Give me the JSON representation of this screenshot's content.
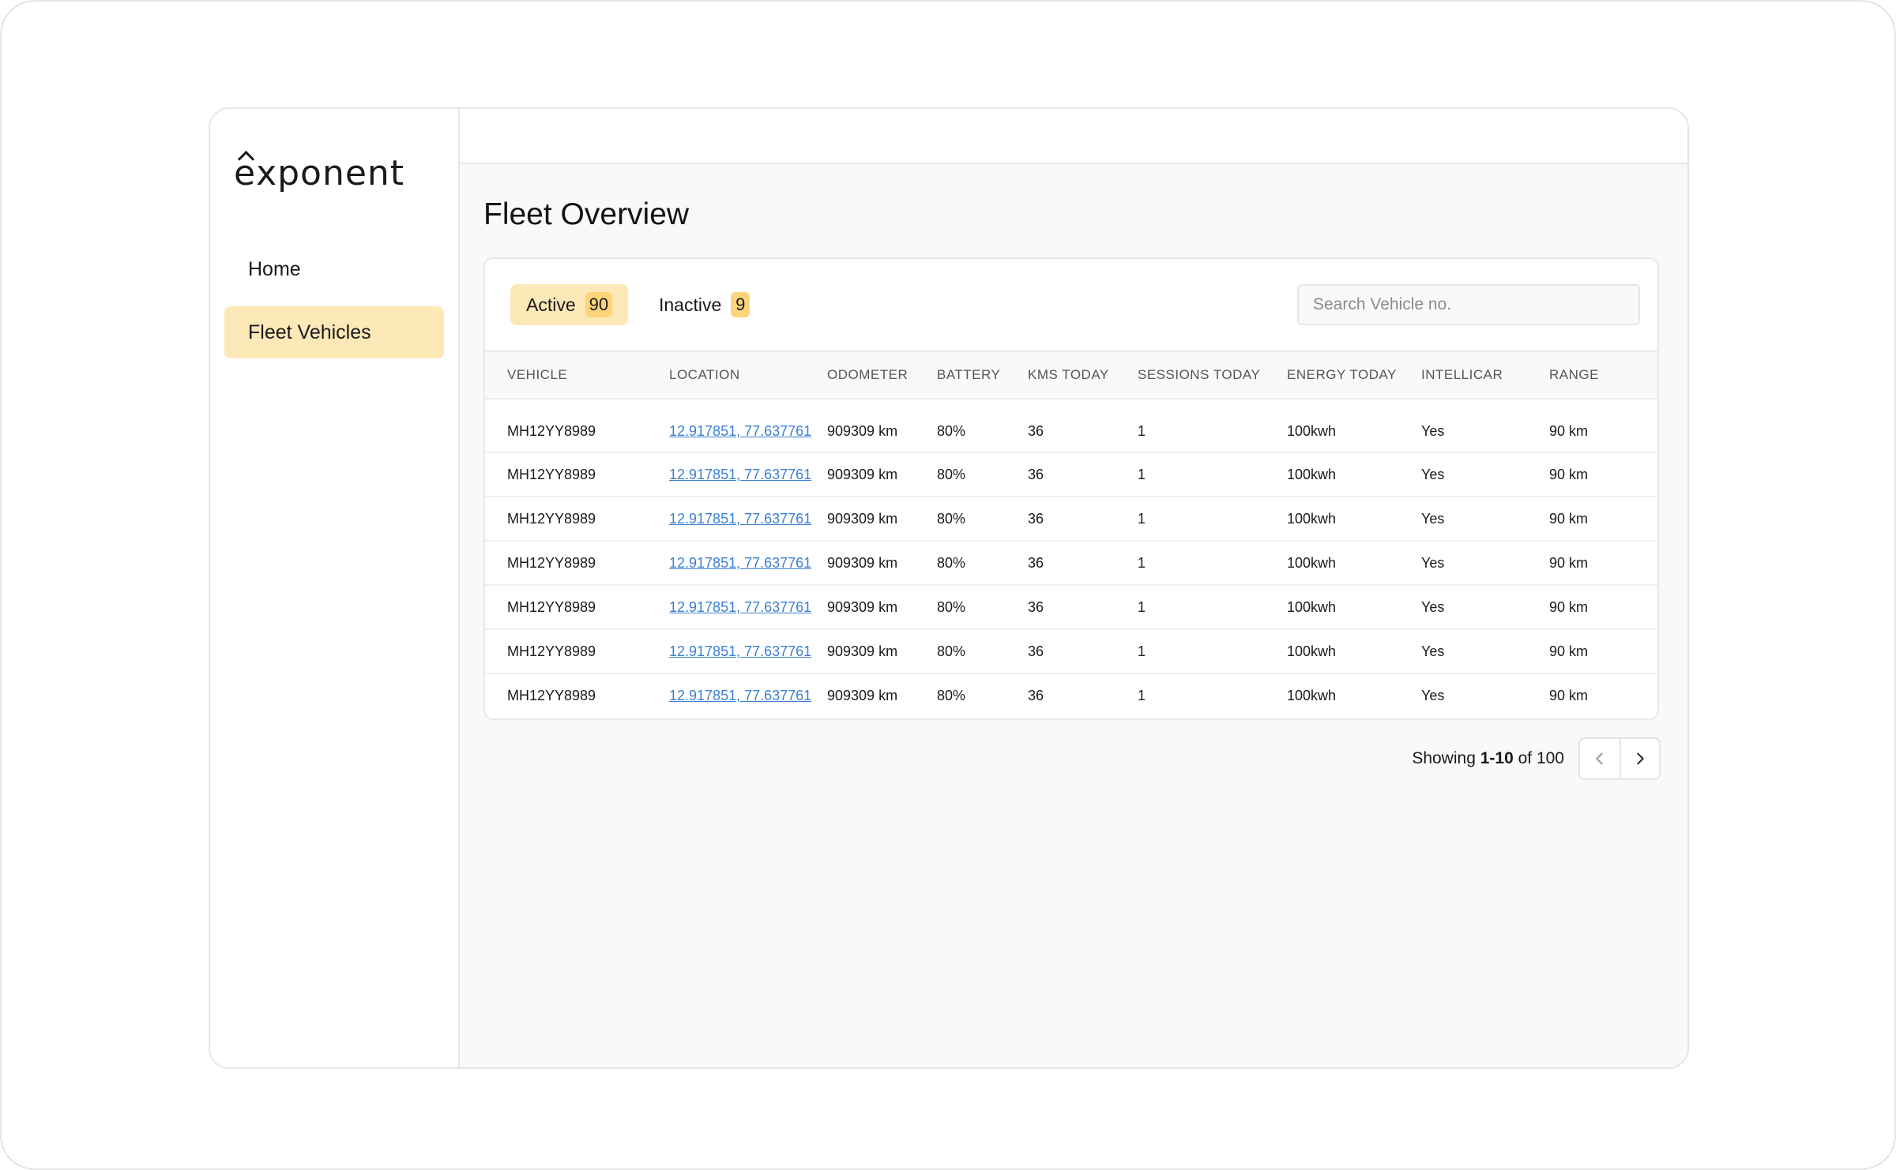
{
  "app": {
    "logo_text": "exponent"
  },
  "sidebar": {
    "items": [
      {
        "label": "Home",
        "active": false
      },
      {
        "label": "Fleet Vehicles",
        "active": true
      }
    ]
  },
  "page": {
    "title": "Fleet Overview"
  },
  "tabs": [
    {
      "label": "Active",
      "count": "90",
      "active": true
    },
    {
      "label": "Inactive",
      "count": "9",
      "active": false
    }
  ],
  "search": {
    "placeholder": "Search Vehicle no.",
    "value": ""
  },
  "table": {
    "columns": [
      "VEHICLE",
      "LOCATION",
      "ODOMETER",
      "BATTERY",
      "KMS TODAY",
      "SESSIONS TODAY",
      "ENERGY TODAY",
      "INTELLICAR",
      "RANGE"
    ],
    "rows": [
      [
        "MH12YY8989",
        "12.917851, 77.637761",
        "909309 km",
        "80%",
        "36",
        "1",
        "100kwh",
        "Yes",
        "90 km"
      ],
      [
        "MH12YY8989",
        "12.917851, 77.637761",
        "909309 km",
        "80%",
        "36",
        "1",
        "100kwh",
        "Yes",
        "90 km"
      ],
      [
        "MH12YY8989",
        "12.917851, 77.637761",
        "909309 km",
        "80%",
        "36",
        "1",
        "100kwh",
        "Yes",
        "90 km"
      ],
      [
        "MH12YY8989",
        "12.917851, 77.637761",
        "909309 km",
        "80%",
        "36",
        "1",
        "100kwh",
        "Yes",
        "90 km"
      ],
      [
        "MH12YY8989",
        "12.917851, 77.637761",
        "909309 km",
        "80%",
        "36",
        "1",
        "100kwh",
        "Yes",
        "90 km"
      ],
      [
        "MH12YY8989",
        "12.917851, 77.637761",
        "909309 km",
        "80%",
        "36",
        "1",
        "100kwh",
        "Yes",
        "90 km"
      ],
      [
        "MH12YY8989",
        "12.917851, 77.637761",
        "909309 km",
        "80%",
        "36",
        "1",
        "100kwh",
        "Yes",
        "90 km"
      ]
    ]
  },
  "pagination": {
    "prefix": "Showing",
    "range": "1-10",
    "of_label": "of",
    "total": "100",
    "prev_icon": "chevron-left-icon",
    "next_icon": "chevron-right-icon"
  },
  "colors": {
    "accent_bg": "#fde8b8",
    "badge_bg": "#fcd57a",
    "link": "#3b7fd1"
  }
}
